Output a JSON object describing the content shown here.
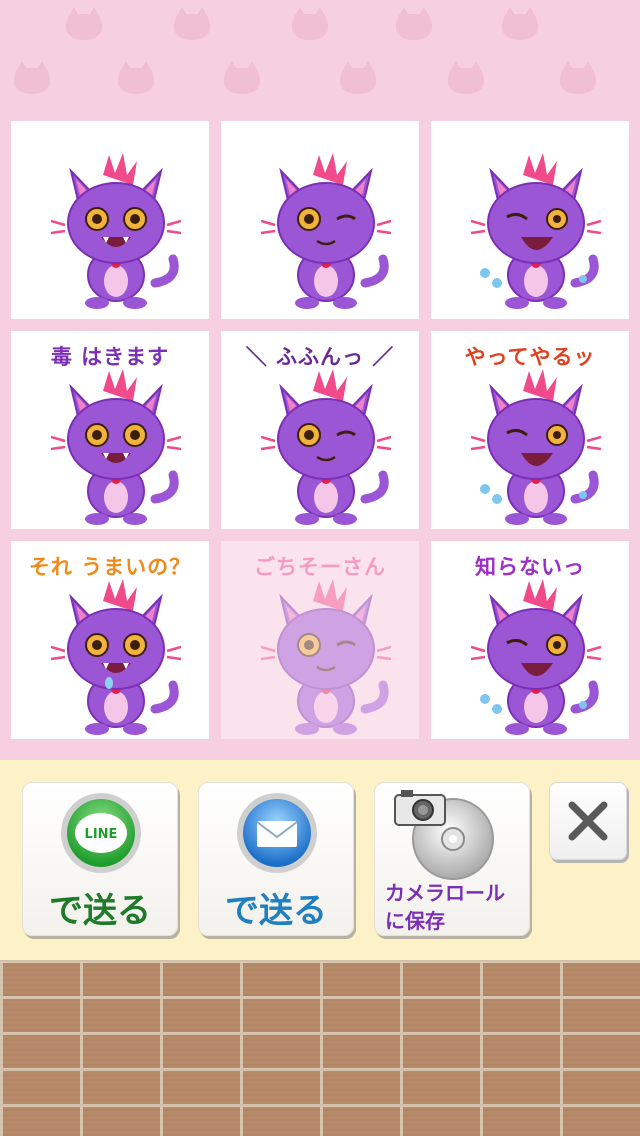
{
  "stickers": [
    {
      "caption": "",
      "caption_color": "#7b2fb5",
      "expression": "happy",
      "selected": false
    },
    {
      "caption": "",
      "caption_color": "#7b2fb5",
      "expression": "wink",
      "selected": false
    },
    {
      "caption": "",
      "caption_color": "#7b2fb5",
      "expression": "cry",
      "selected": false
    },
    {
      "caption": "毒 はきます",
      "caption_color": "#7b2fb5",
      "expression": "happy",
      "selected": false
    },
    {
      "caption": "＼ ふふんっ ／",
      "caption_color": "#6a2a9a",
      "expression": "wink",
      "selected": false
    },
    {
      "caption": "やってやるッ",
      "caption_color": "#e0401f",
      "expression": "angry",
      "selected": false
    },
    {
      "caption": "それ うまいの？",
      "caption_color": "#f08a1a",
      "expression": "drool",
      "selected": false
    },
    {
      "caption": "ごちそーさん",
      "caption_color": "#f59bc2",
      "expression": "wink",
      "selected": true
    },
    {
      "caption": "知らないっ",
      "caption_color": "#9b2fc8",
      "expression": "cry",
      "selected": false
    }
  ],
  "actions": {
    "line": {
      "badge": "LINE",
      "label": "で送る"
    },
    "mail": {
      "label": "で送る"
    },
    "camera_roll": {
      "label_line1": "カメラロール",
      "label_line2": "に保存"
    },
    "close": {
      "icon": "close-icon"
    }
  },
  "colors": {
    "background_pink": "#f6cfe0",
    "panel_cream": "#fdf1c8",
    "label_green": "#1f7a2a",
    "label_blue": "#1f7fbf",
    "label_purple": "#7b2fb5",
    "line_green": "#27b03a"
  }
}
